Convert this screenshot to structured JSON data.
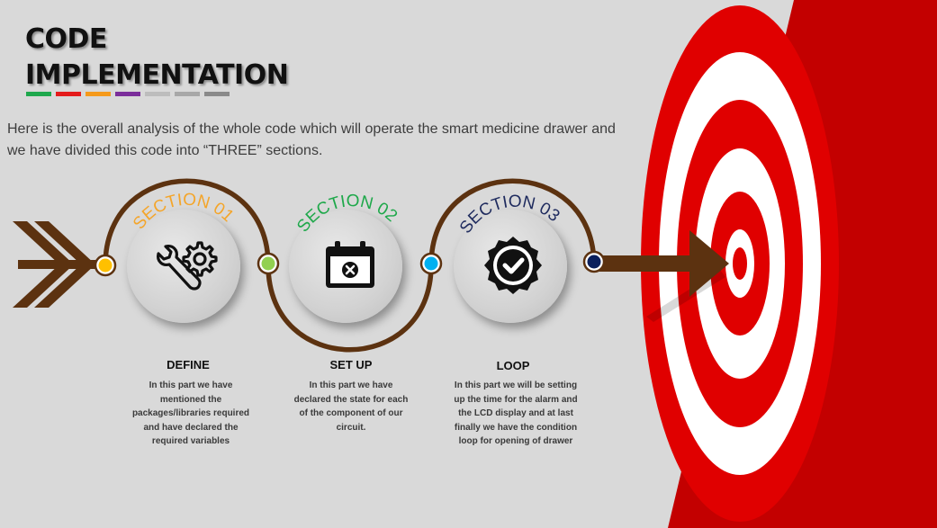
{
  "slide": {
    "title_line1": "CODE",
    "title_line2": "IMPLEMENTATION",
    "intro": "Here is the overall analysis of the whole code which will operate the smart medicine drawer and we have divided this code into “THREE” sections.",
    "colors": {
      "background": "#d9d9d9",
      "path": "#5c3210",
      "target_red": "#e00000",
      "target_backdrop": "#c30000"
    },
    "color_bar": [
      "#1fa84d",
      "#e41b1b",
      "#f59a1b",
      "#7b2e9b",
      "#bdbdbd",
      "#a8a8a8",
      "#8a8a8a"
    ],
    "sections": [
      {
        "label": "SECTION 01",
        "label_color": "#f4a52a",
        "dot_color": "#ffc000",
        "icon": "wrench-gear-icon",
        "heading": "DEFINE",
        "description": "In this part we have mentioned the packages/libraries required and have declared the required variables"
      },
      {
        "label": "SECTION 02",
        "label_color": "#1ea84a",
        "dot_color": "#92d050",
        "icon": "calendar-x-icon",
        "heading": "SET UP",
        "description": "In this part we have declared the state for each of the component of our circuit."
      },
      {
        "label": "SECTION 03",
        "label_color": "#1f2b5e",
        "dot_color": "#00b0f0",
        "icon": "check-badge-icon",
        "heading": "LOOP",
        "description": "In this part we will be setting up the time for the alarm and the LCD display and at last finally we have the condition loop for opening of drawer"
      }
    ],
    "end_dot_color": "#0a1f5c"
  }
}
